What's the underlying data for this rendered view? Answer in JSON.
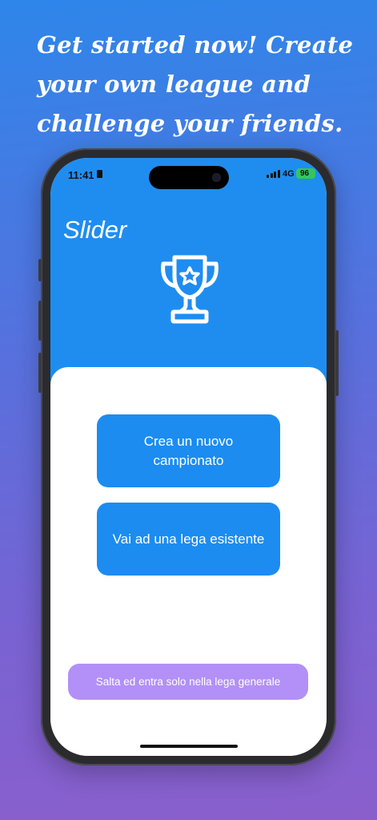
{
  "headline": "Get started now! Create\nyour own league and\nchallenge your friends.",
  "status_bar": {
    "time": "11:41",
    "network": "4G",
    "battery": "96"
  },
  "app": {
    "title": "Slider",
    "trophy_icon": "trophy-star-icon",
    "create_button": "Crea un nuovo campionato",
    "join_button": "Vai ad una lega esistente",
    "skip_button": "Salta ed entra solo nella lega generale"
  },
  "colors": {
    "header_blue": "#1f8df0",
    "button_blue": "#1c8cf0",
    "skip_purple": "#b290f7",
    "battery_green": "#34c759"
  }
}
